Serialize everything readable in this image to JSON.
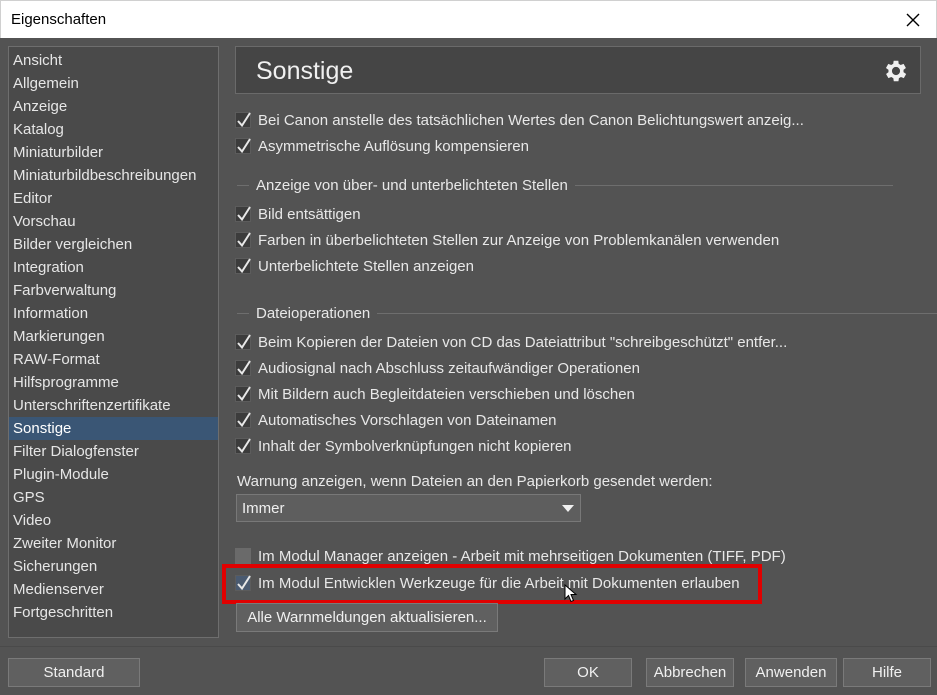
{
  "window": {
    "title": "Eigenschaften"
  },
  "sidebar": {
    "items": [
      {
        "label": "Ansicht"
      },
      {
        "label": "Allgemein"
      },
      {
        "label": "Anzeige"
      },
      {
        "label": "Katalog"
      },
      {
        "label": "Miniaturbilder"
      },
      {
        "label": "Miniaturbildbeschreibungen"
      },
      {
        "label": "Editor"
      },
      {
        "label": "Vorschau"
      },
      {
        "label": "Bilder vergleichen"
      },
      {
        "label": "Integration"
      },
      {
        "label": "Farbverwaltung"
      },
      {
        "label": "Information"
      },
      {
        "label": "Markierungen"
      },
      {
        "label": "RAW-Format"
      },
      {
        "label": "Hilfsprogramme"
      },
      {
        "label": "Unterschriftenzertifikate"
      },
      {
        "label": "Sonstige",
        "selected": true
      },
      {
        "label": "Filter Dialogfenster"
      },
      {
        "label": "Plugin-Module"
      },
      {
        "label": "GPS"
      },
      {
        "label": "Video"
      },
      {
        "label": "Zweiter Monitor"
      },
      {
        "label": "Sicherungen"
      },
      {
        "label": "Medienserver"
      },
      {
        "label": "Fortgeschritten"
      }
    ]
  },
  "panel": {
    "title": "Sonstige",
    "icon": "gear-icon",
    "checkboxes_top": [
      {
        "label": "Bei Canon anstelle des tatsächlichen Wertes den Canon Belichtungswert anzeig...",
        "checked": true
      },
      {
        "label": "Asymmetrische Auflösung kompensieren",
        "checked": true
      }
    ],
    "group_exposure": {
      "title": "Anzeige von über- und unterbelichteten Stellen",
      "items": [
        {
          "label": "Bild entsättigen",
          "checked": true
        },
        {
          "label": "Farben in überbelichteten Stellen zur Anzeige von Problemkanälen verwenden",
          "checked": true
        },
        {
          "label": "Unterbelichtete Stellen anzeigen",
          "checked": true
        }
      ]
    },
    "group_fileops": {
      "title": "Dateioperationen",
      "items": [
        {
          "label": "Beim Kopieren der Dateien von CD das Dateiattribut \"schreibgeschützt\" entfer...",
          "checked": true
        },
        {
          "label": "Audiosignal nach Abschluss zeitaufwändiger Operationen",
          "checked": true
        },
        {
          "label": "Mit Bildern auch Begleitdateien verschieben und löschen",
          "checked": true
        },
        {
          "label": "Automatisches Vorschlagen von Dateinamen",
          "checked": true
        },
        {
          "label": "Inhalt der Symbolverknüpfungen nicht kopieren",
          "checked": true
        }
      ]
    },
    "trash_warning": {
      "label": "Warnung anzeigen, wenn Dateien an den Papierkorb gesendet werden:",
      "selected": "Immer"
    },
    "checkboxes_bottom": [
      {
        "label": "Im Modul Manager anzeigen - Arbeit mit mehrseitigen Dokumenten (TIFF, PDF)",
        "checked": false
      },
      {
        "label": "Im Modul Entwicklen Werkzeuge für die Arbeit mit Dokumenten erlauben",
        "checked": true
      }
    ],
    "refresh_warnings_button": "Alle Warnmeldungen aktualisieren..."
  },
  "footer": {
    "standard": "Standard",
    "ok": "OK",
    "cancel": "Abbrechen",
    "apply": "Anwenden",
    "help": "Hilfe"
  },
  "colors": {
    "background": "#535353",
    "selection": "#3a5675",
    "highlight_border": "#e00000"
  }
}
